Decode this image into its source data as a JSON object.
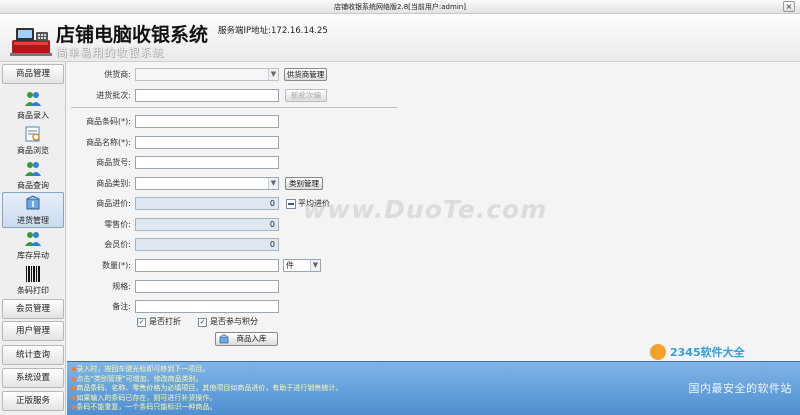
{
  "window": {
    "title": "店铺收银系统网络版2.8[当前用户:admin]",
    "close": "×"
  },
  "header": {
    "app_title": "店铺电脑收银系统",
    "server_label": "服务端IP地址:172.16.14.25",
    "subtitle": "简单易用的收银系统"
  },
  "sidebar": {
    "sections": [
      {
        "label": "商品管理"
      },
      {
        "label": "会员管理"
      },
      {
        "label": "用户管理"
      },
      {
        "label": "统计查询"
      },
      {
        "label": "系统设置"
      },
      {
        "label": "正版服务"
      }
    ],
    "items": [
      {
        "label": "商品录入",
        "icon": "people-icon"
      },
      {
        "label": "商品浏览",
        "icon": "browse-icon"
      },
      {
        "label": "商品查询",
        "icon": "people-search-icon"
      },
      {
        "label": "进货管理",
        "icon": "stock-in-icon"
      },
      {
        "label": "库存异动",
        "icon": "people-move-icon"
      },
      {
        "label": "条码打印",
        "icon": "barcode-icon"
      }
    ],
    "active_item": "进货管理"
  },
  "form": {
    "supplier": {
      "label": "供货商:",
      "value": "",
      "manage_button": "供货商管理"
    },
    "batch": {
      "label": "进货批次:",
      "value": "",
      "button": "新批次编"
    },
    "barcode": {
      "label": "商品条码(*):",
      "value": ""
    },
    "name": {
      "label": "商品名称(*):",
      "value": ""
    },
    "item_no": {
      "label": "商品货号:",
      "value": ""
    },
    "category": {
      "label": "商品类别:",
      "value": "",
      "manage_button": "类别管理"
    },
    "purchase_price": {
      "label": "商品进价:",
      "value": "0",
      "avg_label": "平均进价"
    },
    "retail_price": {
      "label": "零售价:",
      "value": "0"
    },
    "member_price": {
      "label": "会员价:",
      "value": "0"
    },
    "quantity": {
      "label": "数量(*):",
      "value": "",
      "unit": "件"
    },
    "spec": {
      "label": "规格:",
      "value": ""
    },
    "remark": {
      "label": "备注:",
      "value": ""
    },
    "print_checkbox": {
      "label": "是否打折",
      "checked": true
    },
    "points_checkbox": {
      "label": "是否参与积分",
      "checked": true
    },
    "submit_button": "商品入库"
  },
  "watermarks": {
    "duote": "www.DuoTe.com",
    "brand": "2345软件大全",
    "slogan": "国内最安全的软件站"
  },
  "notes": [
    "录入时，按回车键光标即可移到下一项目。",
    "点击“类别管理”可增加、修改商品类别。",
    "商品条码、名称、零售价格为必填项目，其他项目如商品进价，有助于进行销售统计。",
    "如果输入的条码已存在，则可进行补货操作。",
    "条码不能重复，一个条码只能标识一种商品。"
  ]
}
